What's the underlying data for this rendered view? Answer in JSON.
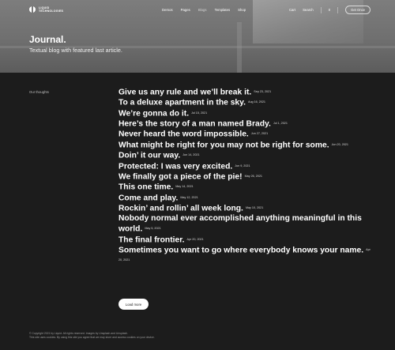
{
  "brand": {
    "line1": "LIQUID",
    "line2": "TECHNOLOGIES"
  },
  "nav": {
    "items": [
      "Demos",
      "Pages",
      "Blogs",
      "Templates",
      "Shop"
    ]
  },
  "topbar": {
    "cart": "Cart",
    "search": "Search",
    "count": "0",
    "cta": "Get Once"
  },
  "hero": {
    "title": "Journal.",
    "subtitle": "Textual blog with featured last article."
  },
  "section": {
    "label": "Our thoughts"
  },
  "posts": [
    {
      "title": "Give us any rule and we’ll break it.",
      "date": "Sep 23, 2021"
    },
    {
      "title": "To a deluxe apartment in the sky.",
      "date": "Aug 16, 2021"
    },
    {
      "title": "We’re gonna do it.",
      "date": "Jul 15, 2021"
    },
    {
      "title": "Here’s the story of a man named Brady.",
      "date": "Jul 1, 2021"
    },
    {
      "title": "Never heard the word impossible.",
      "date": "Jun 27, 2021"
    },
    {
      "title": "What might be right for you may not be right for some.",
      "date": "Jun 20, 2021"
    },
    {
      "title": "Doin’ it our way.",
      "date": "Jun 14, 2021"
    },
    {
      "title": "Protected: I was very excited.",
      "date": "Jun 9, 2021"
    },
    {
      "title": "We finally got a piece of the pie!",
      "date": "May 26, 2021"
    },
    {
      "title": "This one time.",
      "date": "May 14, 2021"
    },
    {
      "title": "Come and play.",
      "date": "May 12, 2021"
    },
    {
      "title": "Rockin’ and rollin’ all week long.",
      "date": "May 10, 2021"
    },
    {
      "title": "Nobody normal ever accomplished anything meaningful in this world.",
      "date": "May 5, 2021"
    },
    {
      "title": "The final frontier.",
      "date": "Apr 20, 2021"
    },
    {
      "title": "Sometimes you want to go where everybody knows your name.",
      "date": "Apr 20, 2021"
    }
  ],
  "load_more": "Load more",
  "footer": {
    "line1": "© Copyright 2021 by Liquid. All rights reserved. Images by Unsplash and Unsplash.",
    "line2": "This site uses cookies. By using this site you agree that we may store and access cookies on your device."
  },
  "colors": {
    "background": "#1c1c1c",
    "hero": "#757575",
    "text": "#ffffff"
  },
  "icons": {
    "logo": "liquid-logo-icon"
  }
}
